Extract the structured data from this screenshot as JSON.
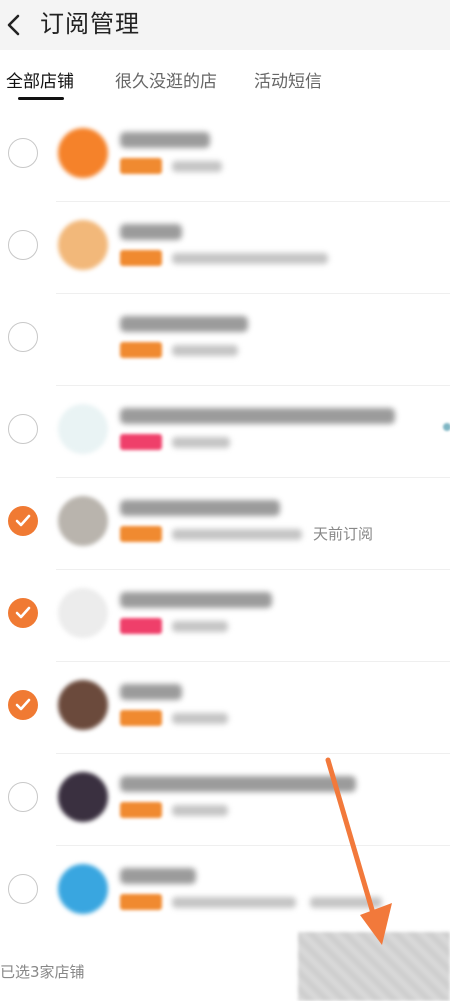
{
  "header": {
    "title": "订阅管理"
  },
  "tabs": [
    {
      "label": "全部店铺",
      "active": true
    },
    {
      "label": "很久没逛的店",
      "active": false
    },
    {
      "label": "活动短信",
      "active": false
    }
  ],
  "subscriptions": [
    {
      "checked": false,
      "tag_color": "#f08a30",
      "avatar_color": "#f5822a"
    },
    {
      "checked": false,
      "tag_color": "#f08a30",
      "avatar_color": "#f2b87a"
    },
    {
      "checked": false,
      "tag_color": "#f08a30",
      "avatar_color": "#ffffff"
    },
    {
      "checked": false,
      "tag_color": "#ef3f6a",
      "avatar_color": "#e9f3f4"
    },
    {
      "checked": true,
      "tag_color": "#f08a30",
      "avatar_color": "#b9b4ad",
      "subscribed_text": "天前订阅"
    },
    {
      "checked": true,
      "tag_color": "#ef3f6a",
      "avatar_color": "#ececec"
    },
    {
      "checked": true,
      "tag_color": "#f08a30",
      "avatar_color": "#6b4a3c"
    },
    {
      "checked": false,
      "tag_color": "#f08a30",
      "avatar_color": "#3a3040"
    },
    {
      "checked": false,
      "tag_color": "#f08a30",
      "avatar_color": "#39a6e0"
    }
  ],
  "footer": {
    "selected_text": "已选3家店铺"
  },
  "colors": {
    "accent": "#f07a33",
    "arrow": "#f2793b"
  }
}
